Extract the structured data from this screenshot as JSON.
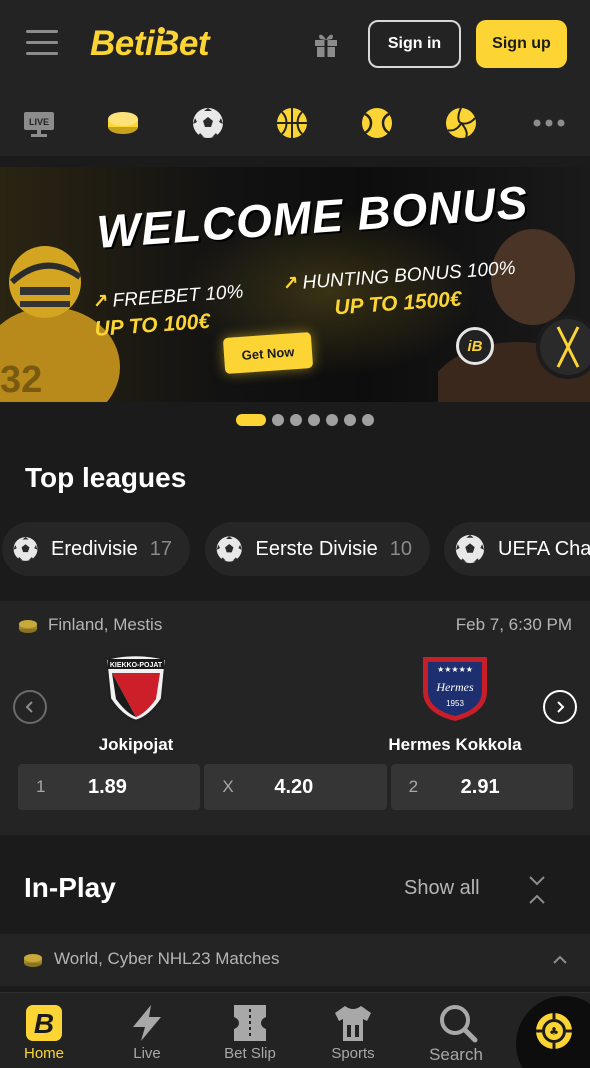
{
  "header": {
    "logo": "BetiBet",
    "signin_label": "Sign in",
    "signup_label": "Sign up"
  },
  "sport_nav": {
    "items": [
      {
        "icon": "live-tv-icon",
        "label": "LIVE"
      },
      {
        "icon": "hockey-puck-icon"
      },
      {
        "icon": "soccer-ball-icon"
      },
      {
        "icon": "basketball-icon"
      },
      {
        "icon": "tennis-ball-icon"
      },
      {
        "icon": "volleyball-icon"
      },
      {
        "icon": "more-icon"
      }
    ]
  },
  "banner": {
    "title": "WELCOME BONUS",
    "promo1_line1": "FREEBET 10%",
    "promo1_line2": "UP TO 100€",
    "promo2_line1": "HUNTING BONUS 100%",
    "promo2_line2": "UP TO 1500€",
    "cta": "Get Now",
    "badge": "iB",
    "slides": 7,
    "active_slide": 1
  },
  "top_leagues": {
    "title": "Top leagues",
    "items": [
      {
        "name": "Eredivisie",
        "count": "17"
      },
      {
        "name": "Eerste Divisie",
        "count": "10"
      },
      {
        "name": "UEFA Cha"
      }
    ]
  },
  "match": {
    "league": "Finland, Mestis",
    "date": "Feb 7, 6:30 PM",
    "home": "Jokipojat",
    "away": "Hermes Kokkola",
    "home_logo_text": "KIEKKO-POJAT",
    "away_logo_text": "Hermes",
    "away_logo_year": "1953",
    "odds": [
      {
        "label": "1",
        "value": "1.89"
      },
      {
        "label": "X",
        "value": "4.20"
      },
      {
        "label": "2",
        "value": "2.91"
      }
    ]
  },
  "in_play": {
    "title": "In-Play",
    "show_all": "Show all",
    "league": "World, Cyber NHL23 Matches"
  },
  "bottom_nav": {
    "items": [
      {
        "label": "Home",
        "icon": "home-b-icon",
        "active": true
      },
      {
        "label": "Live",
        "icon": "lightning-icon"
      },
      {
        "label": "Bet Slip",
        "icon": "betslip-icon"
      },
      {
        "label": "Sports",
        "icon": "jersey-icon"
      },
      {
        "label": "Search",
        "icon": "search-icon"
      }
    ],
    "casino_icon": "casino-chip-icon"
  },
  "colors": {
    "accent": "#fcd535",
    "background": "#1b1b1b",
    "surface": "#242424"
  }
}
